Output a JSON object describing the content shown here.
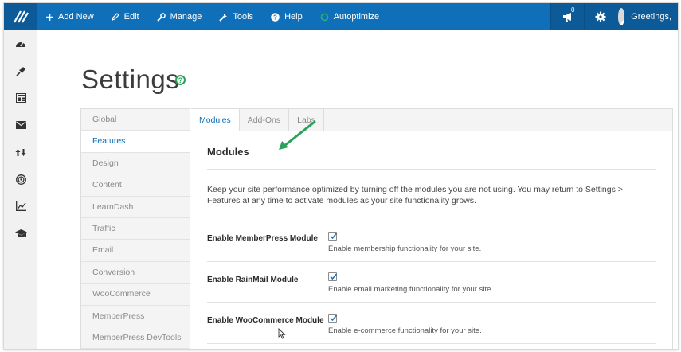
{
  "topbar": {
    "items": [
      {
        "label": "Add New",
        "icon": "plus-icon"
      },
      {
        "label": "Edit",
        "icon": "pencil-icon"
      },
      {
        "label": "Manage",
        "icon": "wrench-icon"
      },
      {
        "label": "Tools",
        "icon": "tools-icon"
      },
      {
        "label": "Help",
        "icon": "question-icon"
      },
      {
        "label": "Autoptimize",
        "icon": "status-circle-icon"
      }
    ],
    "notification_count": "0",
    "greeting": "Greetings,"
  },
  "page": {
    "title": "Settings",
    "help_icon": "?"
  },
  "settings_nav": [
    {
      "label": "Global"
    },
    {
      "label": "Features",
      "active": true
    },
    {
      "label": "Design"
    },
    {
      "label": "Content"
    },
    {
      "label": "LearnDash"
    },
    {
      "label": "Traffic"
    },
    {
      "label": "Email"
    },
    {
      "label": "Conversion"
    },
    {
      "label": "WooCommerce"
    },
    {
      "label": "MemberPress"
    },
    {
      "label": "MemberPress DevTools"
    }
  ],
  "tabs": [
    {
      "label": "Modules",
      "active": true
    },
    {
      "label": "Add-Ons"
    },
    {
      "label": "Labs"
    }
  ],
  "content": {
    "heading": "Modules",
    "intro": "Keep your site performance optimized by turning off the modules you are not using. You may return to Settings > Features at any time to activate modules as your site functionality grows.",
    "modules": [
      {
        "label": "Enable MemberPress Module",
        "checked": true,
        "description": "Enable membership functionality for your site."
      },
      {
        "label": "Enable RainMail Module",
        "checked": true,
        "description": "Enable email marketing functionality for your site."
      },
      {
        "label": "Enable WooCommerce Module",
        "checked": true,
        "description": "Enable e-commerce functionality for your site."
      }
    ]
  },
  "colors": {
    "admin_bar": "#0f6fb8",
    "admin_bar_dark": "#0c5a97",
    "accent_link": "#0f6fb8",
    "annotation_arrow": "#2aa35a"
  }
}
